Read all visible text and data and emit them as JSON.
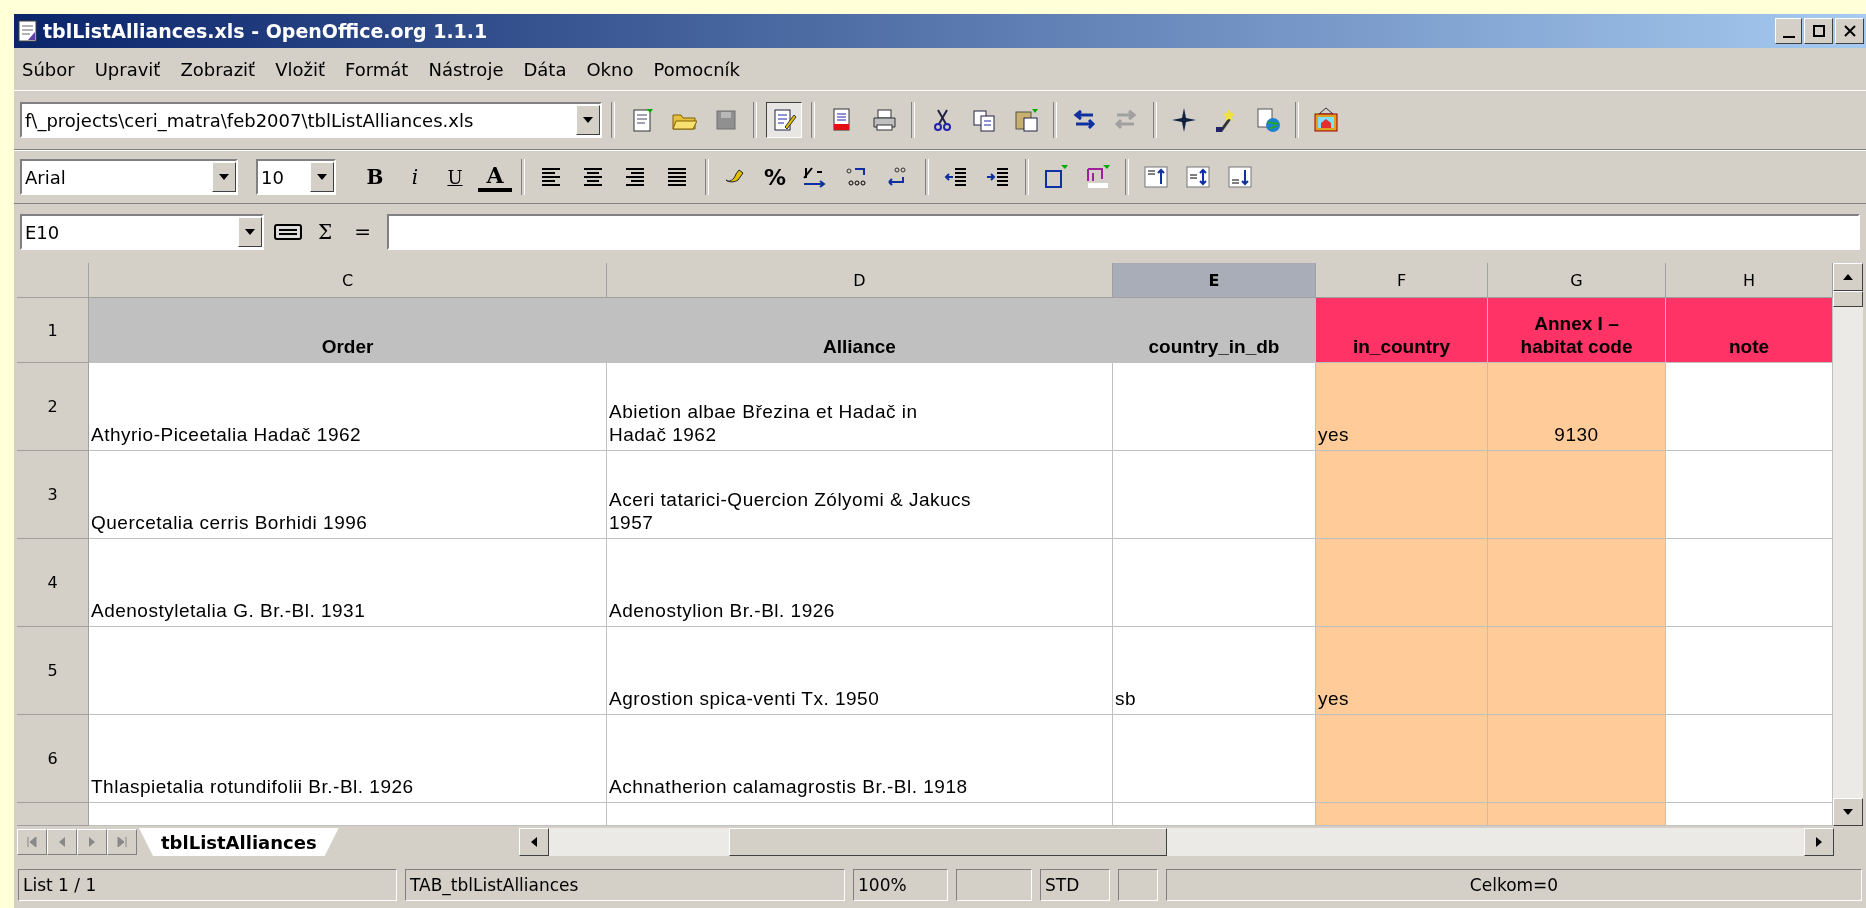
{
  "window": {
    "title": "tblListAlliances.xls - OpenOffice.org 1.1.1"
  },
  "menu": [
    "Súbor",
    "Upraviť",
    "Zobraziť",
    "Vložiť",
    "Formát",
    "Nástroje",
    "Dáta",
    "Okno",
    "Pomocník"
  ],
  "function_bar": {
    "path": "f\\_projects\\ceri_matra\\feb2007\\tblListAlliances.xls",
    "edit_mode": {
      "selected": true
    }
  },
  "format_bar": {
    "font": "Arial",
    "size": "10",
    "style_buttons": [
      {
        "label": "B",
        "kind": "bold"
      },
      {
        "label": "i",
        "kind": "italic"
      },
      {
        "label": "U",
        "kind": "underline"
      },
      {
        "label": "A",
        "kind": "fontcolor"
      }
    ],
    "percent": "%"
  },
  "formula_bar": {
    "name_box": "E10",
    "symbols": [
      "Σ",
      "="
    ]
  },
  "sheet": {
    "columns": [
      {
        "label": "C",
        "selected": false
      },
      {
        "label": "D",
        "selected": false
      },
      {
        "label": "E",
        "selected": true
      },
      {
        "label": "F",
        "selected": false
      },
      {
        "label": "G",
        "selected": false
      },
      {
        "label": "H",
        "selected": false
      }
    ],
    "rows": [
      {
        "label": "1",
        "kind": "header",
        "cells": [
          {
            "text": "Order",
            "color": "#c0c0c0"
          },
          {
            "text": "Alliance",
            "color": "#c0c0c0"
          },
          {
            "text": "country_in_db",
            "color": "#c0c0c0"
          },
          {
            "text": "in_country",
            "color": "#ff3366"
          },
          {
            "text": "Annex I –\nhabitat code",
            "color": "#ff3366"
          },
          {
            "text": "note",
            "color": "#ff3366"
          }
        ]
      },
      {
        "label": "2",
        "kind": "data",
        "cells": [
          {
            "text": "Athyrio-Piceetalia Hadač 1962"
          },
          {
            "text": "Abietion albae Březina et Hadač in\nHadač 1962"
          },
          {},
          {
            "text": "yes",
            "color": "#ffcc99"
          },
          {
            "text": "9130",
            "color": "#ffcc99",
            "centered": true
          },
          {}
        ]
      },
      {
        "label": "3",
        "kind": "data",
        "cells": [
          {
            "text": "Quercetalia cerris Borhidi 1996"
          },
          {
            "text": "Aceri tatarici-Quercion Zólyomi & Jakucs\n1957"
          },
          {},
          {
            "color": "#ffcc99"
          },
          {
            "color": "#ffcc99"
          },
          {}
        ]
      },
      {
        "label": "4",
        "kind": "data",
        "cells": [
          {
            "text": "Adenostyletalia G. Br.-Bl. 1931"
          },
          {
            "text": "Adenostylion Br.-Bl. 1926"
          },
          {},
          {
            "color": "#ffcc99"
          },
          {
            "color": "#ffcc99"
          },
          {}
        ]
      },
      {
        "label": "5",
        "kind": "data",
        "cells": [
          {},
          {
            "text": "Agrostion spica-venti Tx. 1950"
          },
          {
            "text": "sb"
          },
          {
            "text": "yes",
            "color": "#ffcc99"
          },
          {
            "color": "#ffcc99"
          },
          {}
        ]
      },
      {
        "label": "6",
        "kind": "data",
        "cells": [
          {
            "text": "Thlaspietalia rotundifolii Br.-Bl. 1926"
          },
          {
            "text": "Achnatherion calamagrostis Br.-Bl. 1918"
          },
          {},
          {
            "color": "#ffcc99"
          },
          {
            "color": "#ffcc99"
          },
          {}
        ]
      },
      {
        "kind": "partial",
        "cells": [
          {},
          {},
          {},
          {
            "color": "#ffcc99"
          },
          {
            "color": "#ffcc99"
          },
          {}
        ]
      }
    ]
  },
  "sheet_tabs": [
    {
      "label": "tblListAlliances",
      "selected": true
    }
  ],
  "status_bar": [
    {
      "kind": "text",
      "text": "List 1 / 1"
    },
    {
      "kind": "text",
      "text": "TAB_tblListAlliances"
    },
    {
      "kind": "text",
      "text": "100%"
    },
    {
      "kind": "empty"
    },
    {
      "kind": "text",
      "text": "STD"
    },
    {
      "kind": "empty"
    },
    {
      "kind": "center",
      "text": "Celkom=0"
    }
  ]
}
